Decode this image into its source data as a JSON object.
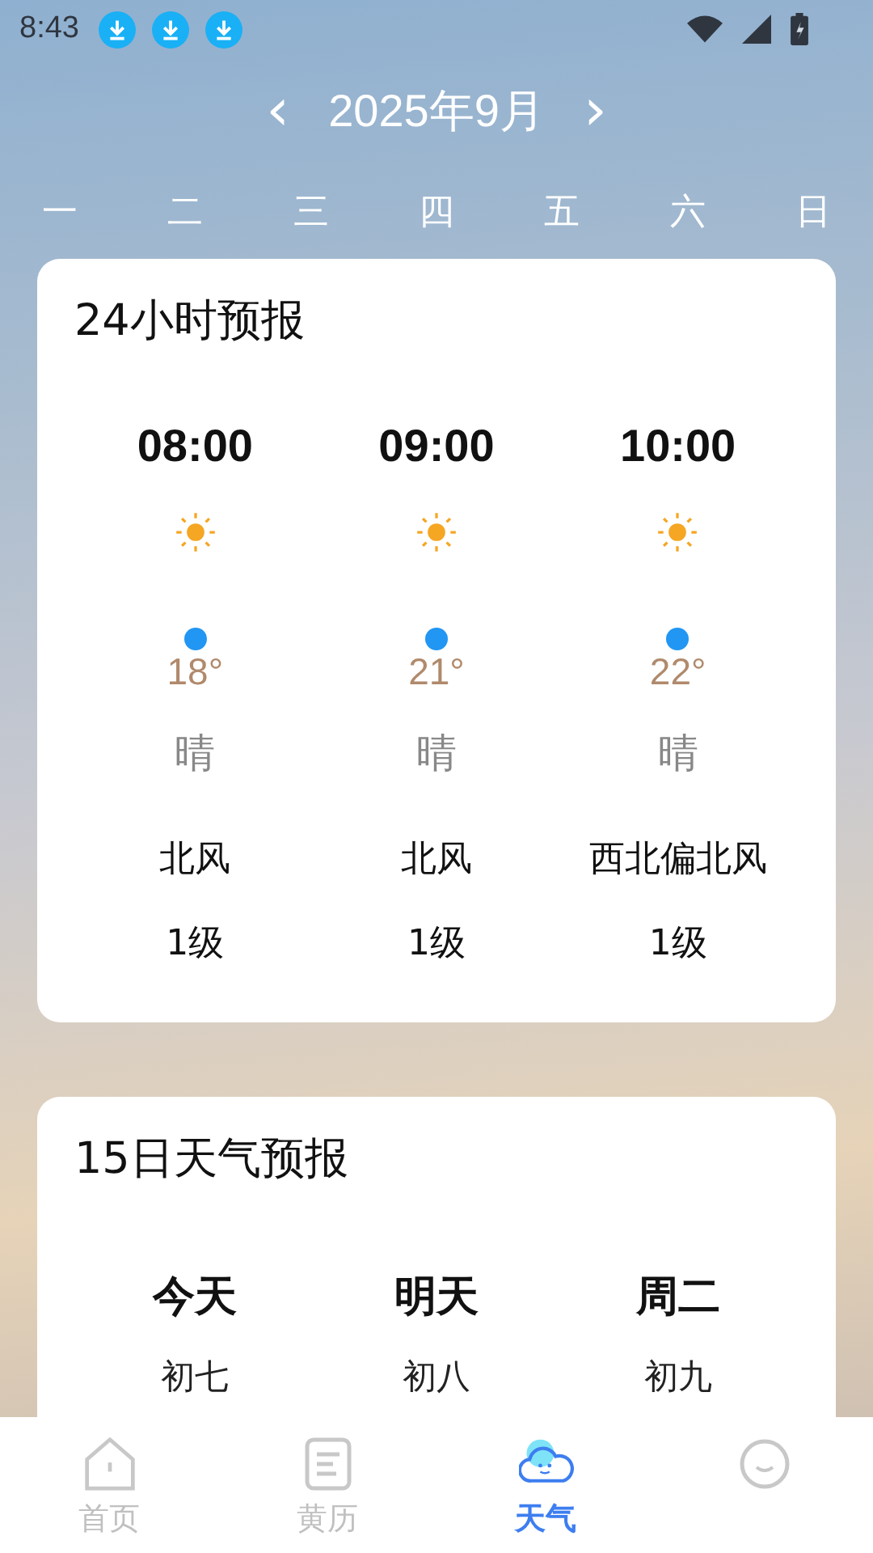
{
  "status_bar": {
    "time": "8:43",
    "notifications": [
      {
        "kind": "download"
      },
      {
        "kind": "download"
      },
      {
        "kind": "download"
      }
    ]
  },
  "month_nav": {
    "prev": "‹",
    "title": "2025年9月",
    "next": "›"
  },
  "weekdays": [
    "一",
    "二",
    "三",
    "四",
    "五",
    "六",
    "日"
  ],
  "hourly": {
    "title": "24小时预报",
    "hours": [
      {
        "time": "08:00",
        "temp": "18°",
        "condition": "晴",
        "wind_dir": "北风",
        "wind_level": "1级"
      },
      {
        "time": "09:00",
        "temp": "21°",
        "condition": "晴",
        "wind_dir": "北风",
        "wind_level": "1级"
      },
      {
        "time": "10:00",
        "temp": "22°",
        "condition": "晴",
        "wind_dir": "西北偏北风",
        "wind_level": "1级"
      }
    ]
  },
  "daily": {
    "title": "15日天气预报",
    "days": [
      {
        "day": "今天",
        "lunar": "初七"
      },
      {
        "day": "明天",
        "lunar": "初八"
      },
      {
        "day": "周二",
        "lunar": "初九"
      }
    ]
  },
  "tabs": [
    {
      "kind": "home",
      "label": "首页",
      "selected": false
    },
    {
      "kind": "almanac",
      "label": "黄历",
      "selected": false
    },
    {
      "kind": "weather",
      "label": "天气",
      "selected": true
    },
    {
      "kind": "profile",
      "selected": false
    }
  ]
}
